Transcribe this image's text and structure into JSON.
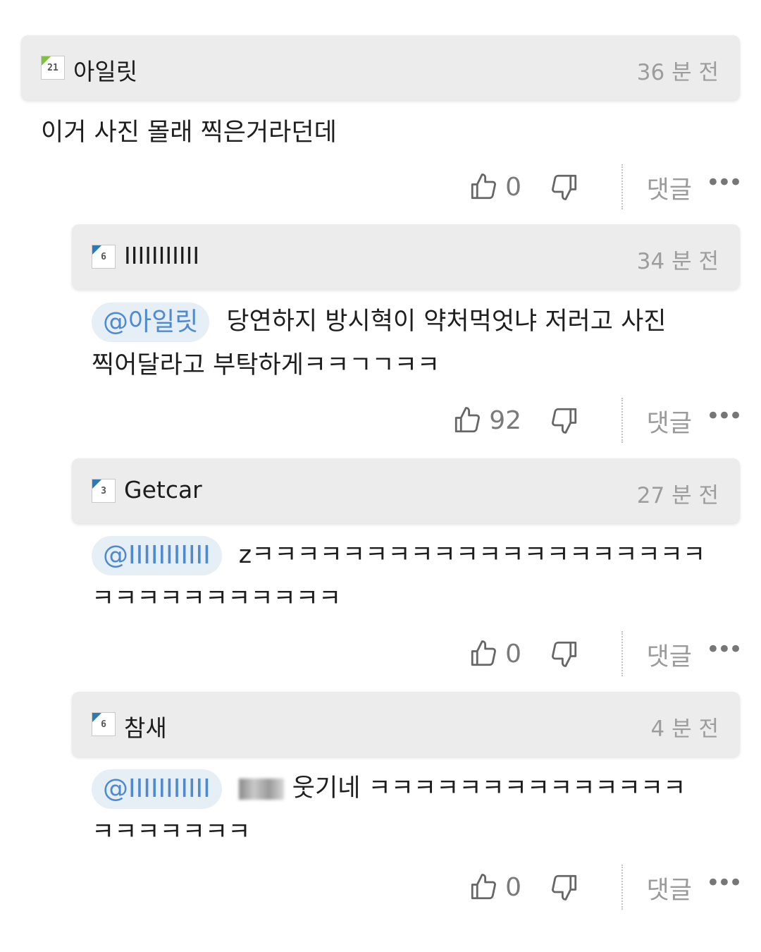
{
  "comments": [
    {
      "username": "아일릿",
      "time": "36 분 전",
      "badge": "21",
      "text": "이거 사진 몰래 찍은거라던데",
      "likes": "0",
      "reply_label": "댓글",
      "more_label": "•••"
    },
    {
      "username": "IIIIIIIIIII",
      "time": "34 분 전",
      "badge": "6",
      "mention": "@아일릿",
      "text_line1": "당연하지 방시혁이 약처먹엇냐 저러고 사진",
      "text_line2": "찍어달라고 부탁하게ㅋㅋㄱㄱㅋㅋ",
      "likes": "92",
      "reply_label": "댓글",
      "more_label": "•••"
    },
    {
      "username": "Getcar",
      "time": "27 분 전",
      "badge": "3",
      "mention": "@IIIIIIIIIII",
      "text_line1": "zㅋㅋㅋㅋㅋㅋㅋㅋㅋㅋㅋㅋㅋㅋㅋㅋㅋㅋㅋㅋ",
      "text_line2": "ㅋㅋㅋㅋㅋㅋㅋㅋㅋㅋㅋ",
      "likes": "0",
      "reply_label": "댓글",
      "more_label": "•••"
    },
    {
      "username": "참새",
      "time": "4 분 전",
      "badge": "6",
      "mention": "@IIIIIIIIIII",
      "text_line1": "웃기네 ㅋㅋㅋㅋㅋㅋㅋㅋㅋㅋㅋㅋㅋㅋ",
      "text_line2": "ㅋㅋㅋㅋㅋㅋㅋ",
      "likes": "0",
      "reply_label": "댓글",
      "more_label": "•••"
    }
  ]
}
